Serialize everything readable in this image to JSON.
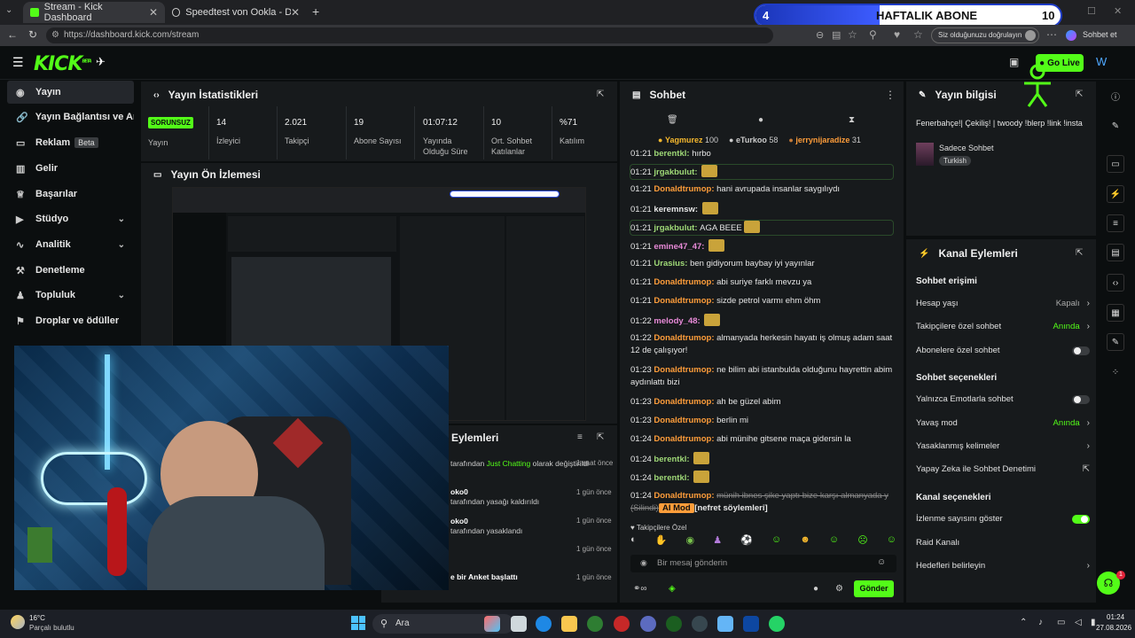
{
  "browser": {
    "tabs": [
      {
        "label": "Stream - Kick Dashboard",
        "active": true
      },
      {
        "label": "Speedtest von Ookla - Der umfass...",
        "active": false
      }
    ],
    "url": "https://dashboard.kick.com/stream",
    "verify_label": "Siz olduğunuzu doğrulayın",
    "sync_label": "Sohbet et"
  },
  "overlay_goal": {
    "left": "4",
    "label": "HAFTALIK ABONE",
    "right": "10"
  },
  "topbar": {
    "logo": "KICK",
    "logo_sup": "BETA",
    "go_live": "Go Live"
  },
  "sidebar": {
    "items": [
      {
        "label": "Yayın",
        "icon": "broadcast-icon"
      },
      {
        "label": "Yayın Bağlantısı ve Anahtar",
        "icon": "link-icon"
      },
      {
        "label": "Reklam",
        "badge": "Beta",
        "icon": "megaphone-icon"
      },
      {
        "label": "Gelir",
        "icon": "chart-icon"
      },
      {
        "label": "Başarılar",
        "icon": "trophy-icon"
      },
      {
        "label": "Stüdyo",
        "icon": "video-icon"
      },
      {
        "label": "Analitik",
        "icon": "analytics-icon"
      },
      {
        "label": "Denetleme",
        "icon": "shield-icon"
      },
      {
        "label": "Topluluk",
        "icon": "community-icon"
      },
      {
        "label": "Droplar ve ödüller",
        "icon": "gift-icon"
      }
    ]
  },
  "stats": {
    "title": "Yayın İstatistikleri",
    "status_badge": "SORUNSUZ",
    "status_label": "Yayın",
    "items": [
      {
        "value": "14",
        "label": "İzleyici"
      },
      {
        "value": "2.021",
        "label": "Takipçi"
      },
      {
        "value": "19",
        "label": "Abone Sayısı"
      },
      {
        "value": "01:07:12",
        "label": "Yayında Olduğu Süre"
      },
      {
        "value": "10",
        "label": "Ort. Sohbet Katılanlar"
      },
      {
        "value": "%71",
        "label": "Katılım"
      }
    ]
  },
  "preview": {
    "title": "Yayın Ön İzlemesi"
  },
  "activity": {
    "title": "Eylemleri",
    "rows": [
      {
        "text_a": "tarafından ",
        "highlight": "Just Chatting",
        "text_b": " olarak değiştirildi",
        "time": "1 saat önce"
      },
      {
        "name": "oko0",
        "text_a": "tarafından yasağı kaldırıldı",
        "time": "1 gün önce"
      },
      {
        "name": "oko0",
        "text_a": "tarafından yasaklandı",
        "time": "1 gün önce"
      },
      {
        "name": "",
        "text_a": "",
        "time": "1 gün önce"
      },
      {
        "name": "e",
        "text_a": "bir Anket başlattı",
        "time": "1 gün önce"
      }
    ]
  },
  "chat": {
    "title": "Sohbet",
    "top_users": [
      {
        "name": "Yagmurez",
        "count": "100"
      },
      {
        "name": "eTurkoo",
        "count": "58"
      },
      {
        "name": "jerrynijaradize",
        "count": "31"
      }
    ],
    "messages": [
      {
        "time": "01:21",
        "user": "berentkl",
        "text": "hırbo",
        "color": "#9fd977"
      },
      {
        "time": "01:21",
        "user": "jrgakbulut",
        "text": "",
        "color": "#9fd977",
        "emote": true
      },
      {
        "time": "01:21",
        "user": "Donaldtrumop",
        "text": "hani avrupada insanlar saygılıydı",
        "color": "#ff9d3a"
      },
      {
        "time": "01:21",
        "user": "keremnsw",
        "text": "",
        "color": "#e6e6e6",
        "emote": true
      },
      {
        "time": "01:21",
        "user": "jrgakbulut",
        "text": "AGA BEEE",
        "color": "#9fd977",
        "emote": true
      },
      {
        "time": "01:21",
        "user": "emine47_47",
        "text": "",
        "color": "#e88ad8",
        "emote": true
      },
      {
        "time": "01:21",
        "user": "Urasius",
        "text": "ben gidiyorum baybay iyi yayınlar",
        "color": "#9fd977"
      },
      {
        "time": "01:21",
        "user": "Donaldtrumop",
        "text": "abi suriye farklı mevzu ya",
        "color": "#ff9d3a"
      },
      {
        "time": "01:21",
        "user": "Donaldtrumop",
        "text": "sizde petrol varmı ehm öhm",
        "color": "#ff9d3a"
      },
      {
        "time": "01:22",
        "user": "melody_48",
        "text": "",
        "color": "#e88ad8",
        "emote": true
      },
      {
        "time": "01:22",
        "user": "Donaldtrumop",
        "text": "almanyada herkesin hayatı iş olmuş adam saat 12 de çalışıyor!",
        "color": "#ff9d3a"
      },
      {
        "time": "01:23",
        "user": "Donaldtrumop",
        "text": "ne bilim abi istanbulda olduğunu hayrettin abim aydınlattı bizi",
        "color": "#ff9d3a"
      },
      {
        "time": "01:23",
        "user": "Donaldtrumop",
        "text": "ah be güzel abim",
        "color": "#ff9d3a"
      },
      {
        "time": "01:23",
        "user": "Donaldtrumop",
        "text": "berlin mi",
        "color": "#ff9d3a"
      },
      {
        "time": "01:24",
        "user": "Donaldtrumop",
        "text": "abi münihe gitsene maça gidersin la",
        "color": "#ff9d3a"
      },
      {
        "time": "01:24",
        "user": "berentkl",
        "text": "",
        "color": "#9fd977",
        "emote": true
      },
      {
        "time": "01:24",
        "user": "berentkl",
        "text": "",
        "color": "#9fd977",
        "emote": true
      },
      {
        "time": "01:24",
        "user": "Donaldtrumop",
        "text": "münih ibnes şike yaptı bize karşı almanyada y (Silindi)",
        "color": "#ff9d3a",
        "mod_tag": "AI Mod",
        "mod_reason": "[nefret söylemleri]"
      }
    ],
    "followers_only": "Takipçilere Özel",
    "input_placeholder": "Bir mesaj gönderin",
    "send_label": "Gönder"
  },
  "stream_info": {
    "title": "Yayın bilgisi",
    "stream_title": "Fenerbahçe!| Çekiliş! | twoody !blerp !link !insta",
    "category": "Sadece Sohbet",
    "tag": "Turkish"
  },
  "channel_actions": {
    "title": "Kanal Eylemleri",
    "sections": [
      {
        "heading": "Sohbet erişimi",
        "rows": [
          {
            "label": "Hesap yaşı",
            "value": "Kapalı",
            "type": "value-grey"
          },
          {
            "label": "Takipçilere özel sohbet",
            "value": "Anında",
            "type": "value-green"
          },
          {
            "label": "Abonelere özel sohbet",
            "value": "",
            "type": "toggle-off"
          }
        ]
      },
      {
        "heading": "Sohbet seçenekleri",
        "rows": [
          {
            "label": "Yalnızca Emotlarla sohbet",
            "value": "",
            "type": "toggle-off"
          },
          {
            "label": "Yavaş mod",
            "value": "Anında",
            "type": "value-green"
          },
          {
            "label": "Yasaklanmış kelimeler",
            "value": "",
            "type": "chevron"
          },
          {
            "label": "Yapay Zeka ile Sohbet Denetimi",
            "value": "",
            "type": "external"
          }
        ]
      },
      {
        "heading": "Kanal seçenekleri",
        "rows": [
          {
            "label": "İzlenme sayısını göster",
            "value": "",
            "type": "toggle-on"
          },
          {
            "label": "Raid Kanalı",
            "value": "",
            "type": "none"
          },
          {
            "label": "Hedefleri belirleyin",
            "value": "",
            "type": "chevron"
          }
        ]
      }
    ]
  },
  "taskbar": {
    "weather_temp": "16°C",
    "weather_desc": "Parçalı bulutlu",
    "search_label": "Ara",
    "time": "01:24",
    "date": "27.08.2026"
  },
  "colors": {
    "accent": "#53fc18",
    "panel": "#171a1c",
    "background": "#0b0e0f",
    "username_orange": "#ff9d3a"
  }
}
